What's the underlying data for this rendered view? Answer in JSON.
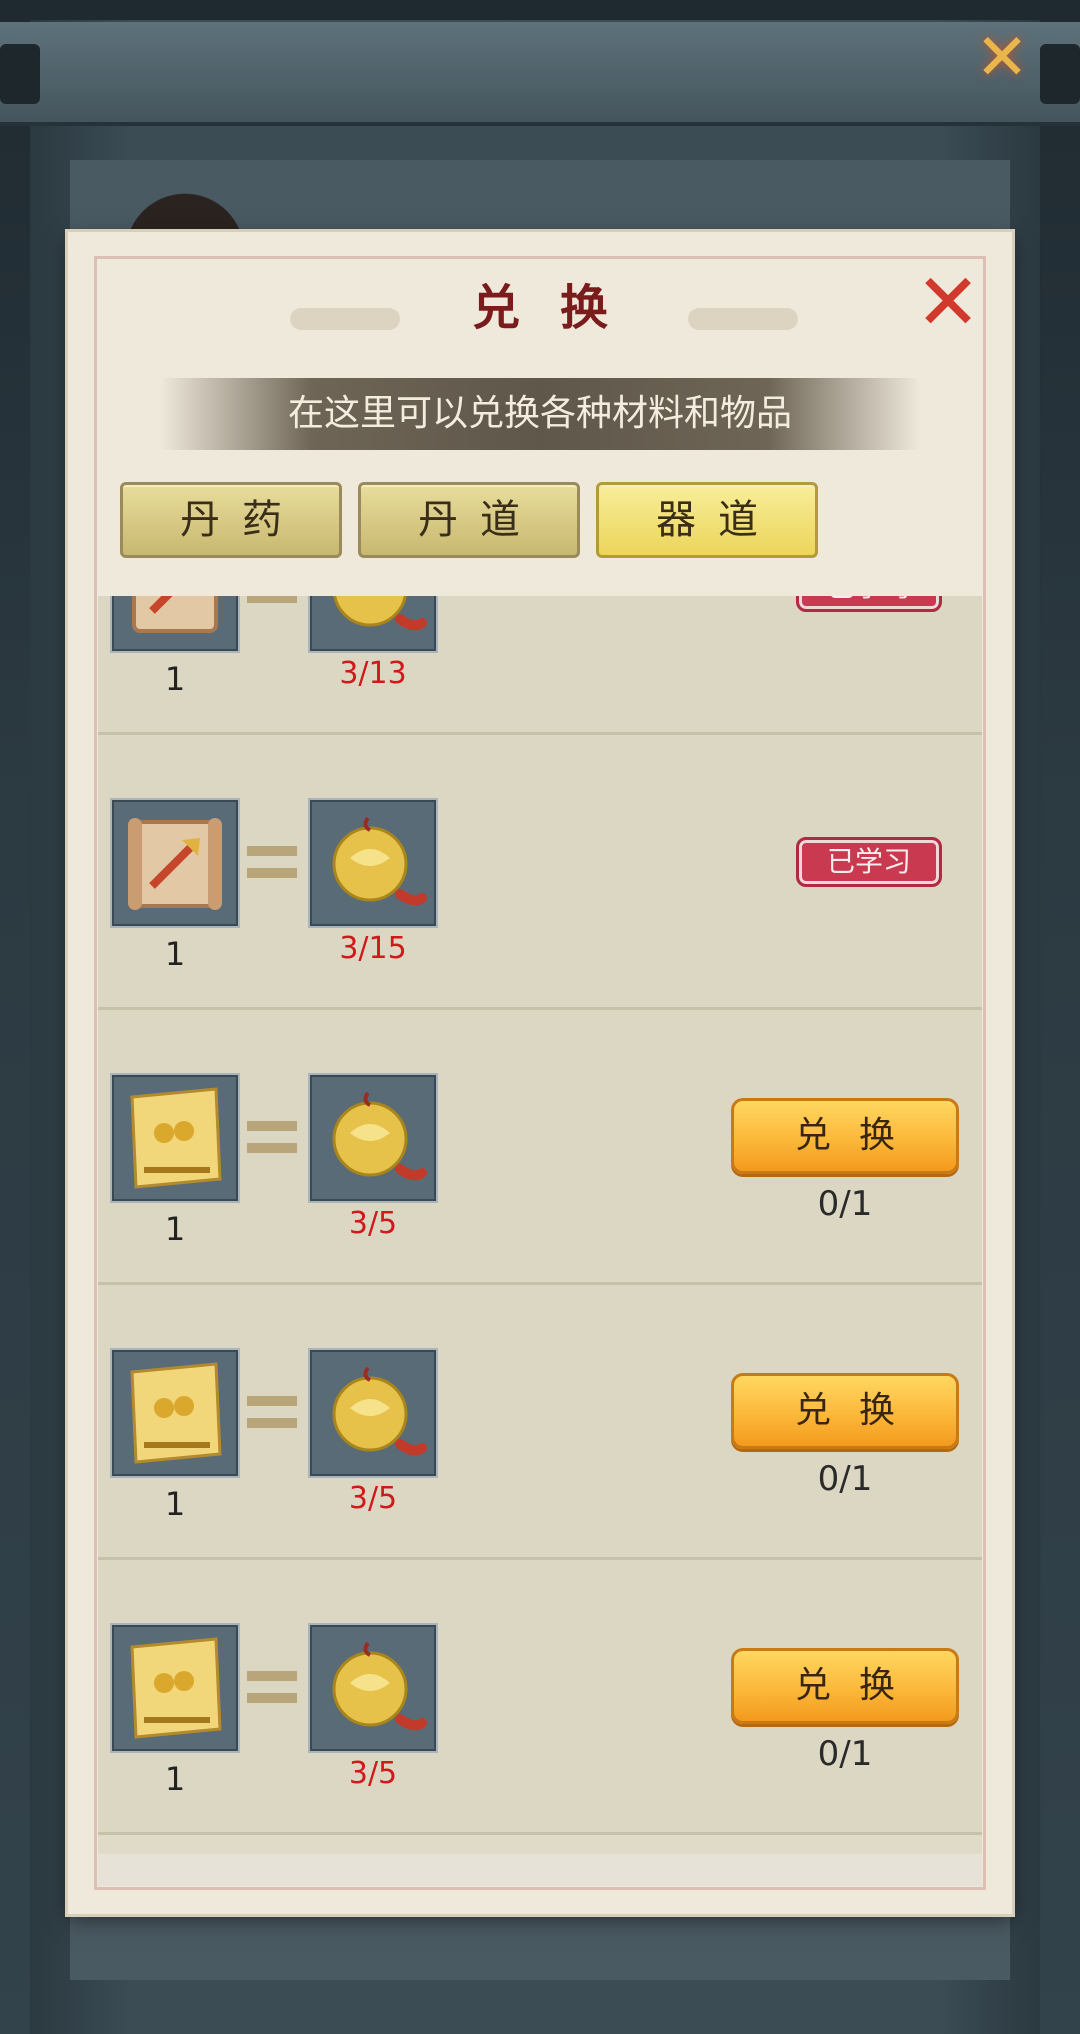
{
  "dialog": {
    "title": "兑换",
    "subtitle": "在这里可以兑换各种材料和物品"
  },
  "tabs": [
    {
      "label": "丹药",
      "active": false
    },
    {
      "label": "丹道",
      "active": false
    },
    {
      "label": "器道",
      "active": true
    }
  ],
  "rows": [
    {
      "input_icon": "weapon-scroll-icon",
      "input_qty": "1",
      "cost_icon": "gold-jade-pendant-icon",
      "cost_progress": "3/13",
      "status": "learned",
      "status_label": "已学习"
    },
    {
      "input_icon": "weapon-scroll-icon",
      "input_qty": "1",
      "cost_icon": "gold-jade-pendant-icon",
      "cost_progress": "3/15",
      "status": "learned",
      "status_label": "已学习"
    },
    {
      "input_icon": "golden-scroll-icon",
      "input_qty": "1",
      "cost_icon": "gold-jade-pendant-icon",
      "cost_progress": "3/5",
      "status": "exchange",
      "button_label": "兑换",
      "limit": "0/1"
    },
    {
      "input_icon": "golden-scroll-icon",
      "input_qty": "1",
      "cost_icon": "gold-jade-pendant-icon",
      "cost_progress": "3/5",
      "status": "exchange",
      "button_label": "兑换",
      "limit": "0/1"
    },
    {
      "input_icon": "golden-scroll-icon",
      "input_qty": "1",
      "cost_icon": "gold-jade-pendant-icon",
      "cost_progress": "3/5",
      "status": "exchange",
      "button_label": "兑换",
      "limit": "0/1"
    }
  ],
  "colors": {
    "title": "#7a1c1c",
    "close": "#d0392c",
    "cost_text": "#d1191b",
    "learned_badge": "#c93a50",
    "exchange_button": "#fcb83a"
  }
}
